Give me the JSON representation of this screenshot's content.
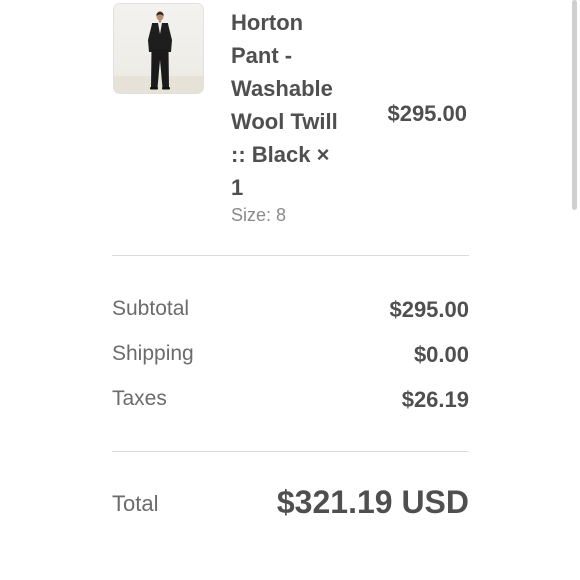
{
  "product": {
    "name": "Horton\nPant -\nWashable\nWool Twill\n:: Black ×\n1",
    "price": "$295.00",
    "variant": "Size: 8",
    "image_icon": "product-photo-person-in-black-suit"
  },
  "summary": {
    "subtotal_label": "Subtotal",
    "subtotal_value": "$295.00",
    "shipping_label": "Shipping",
    "shipping_value": "$0.00",
    "taxes_label": "Taxes",
    "taxes_value": "$26.19"
  },
  "total": {
    "label": "Total",
    "value": "$321.19 USD"
  },
  "colors": {
    "text_strong": "#4f4f4f",
    "text_muted": "#6b6b6b",
    "divider": "#dcdcdc"
  }
}
